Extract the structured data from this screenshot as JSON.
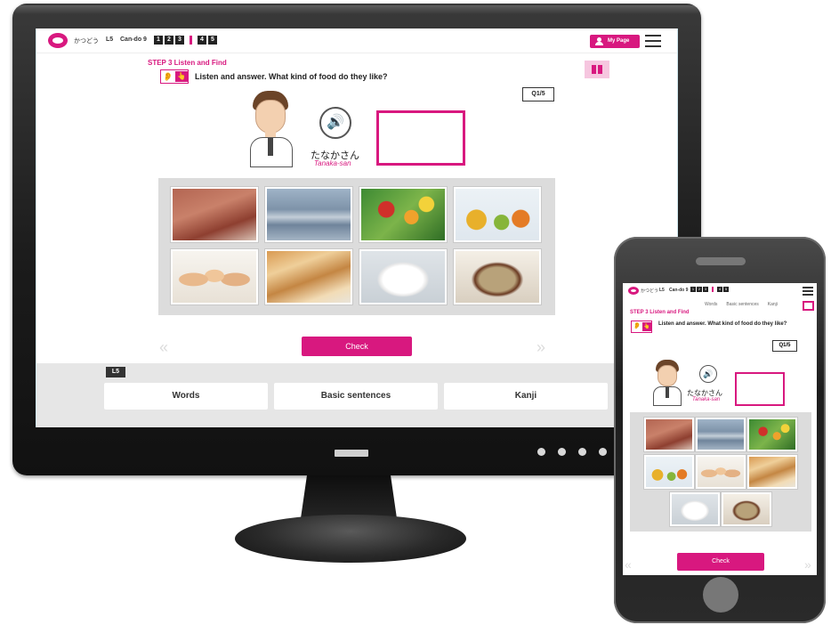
{
  "header": {
    "app_name": "かつどう",
    "lesson": "L5",
    "cando": "Can-do 9",
    "steps": [
      "1",
      "2",
      "3",
      "4",
      "5"
    ],
    "my_page_label": "My Page"
  },
  "task": {
    "step_title": "STEP 3 Listen and Find",
    "instruction": "Listen and answer. What kind of food do they like?",
    "counter": "Q1/5"
  },
  "character": {
    "name_ja": "たなかさん",
    "name_romaji": "Tanaka-san"
  },
  "food_items": [
    {
      "name": "beef",
      "image": "meat"
    },
    {
      "name": "fish",
      "image": "saury"
    },
    {
      "name": "vegetables",
      "image": "vegetables"
    },
    {
      "name": "fruit",
      "image": "fruits"
    },
    {
      "name": "eggs",
      "image": "eggs"
    },
    {
      "name": "bread",
      "image": "toast"
    },
    {
      "name": "rice",
      "image": "rice"
    },
    {
      "name": "miso soup",
      "image": "miso-soup"
    }
  ],
  "nav": {
    "prev_icon": "«",
    "next_icon": "»",
    "check_label": "Check"
  },
  "footer": {
    "lesson_tag": "L5",
    "tabs": [
      "Words",
      "Basic sentences",
      "Kanji"
    ]
  },
  "mobile": {
    "nav_items": [
      "Words",
      "Basic sentences",
      "Kanji"
    ]
  },
  "icons": {
    "ear": "👂",
    "hand": "👆",
    "speaker": "🔊"
  },
  "colors": {
    "accent": "#d8187f",
    "accent_light": "#f6c6df",
    "panel_gray": "#dcdcdc",
    "footer_gray": "#e6e6e6"
  }
}
